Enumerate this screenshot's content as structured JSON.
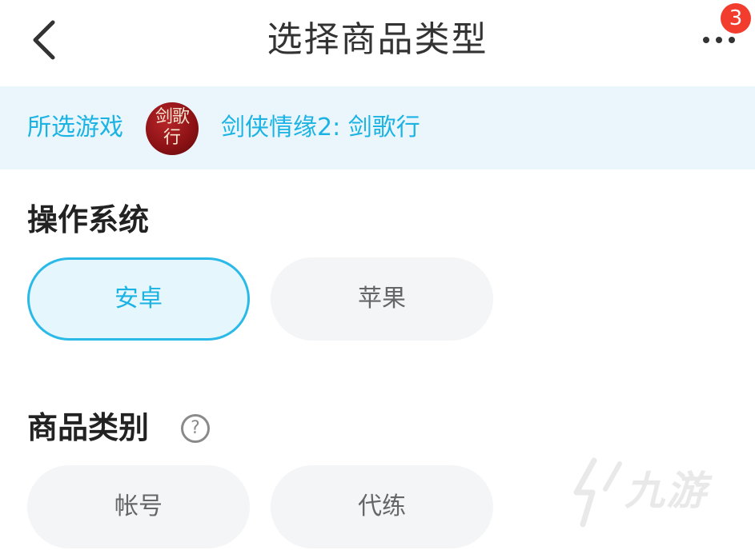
{
  "header": {
    "title": "选择商品类型",
    "back_icon": "chevron-left-icon",
    "more_icon": "more-horizontal-icon",
    "badge_count": "3"
  },
  "game": {
    "label": "所选游戏",
    "logo_text_top": "剑歌",
    "logo_text_bottom": "行",
    "name": "剑侠情缘2: 剑歌行"
  },
  "os": {
    "title": "操作系统",
    "options": [
      {
        "label": "安卓",
        "selected": true
      },
      {
        "label": "苹果",
        "selected": false
      }
    ]
  },
  "category": {
    "title": "商品类别",
    "help_icon": "question-circle-icon",
    "help_glyph": "?",
    "options": [
      {
        "label": "帐号",
        "selected": false
      },
      {
        "label": "代练",
        "selected": false
      }
    ]
  },
  "watermark": {
    "text": "九游"
  },
  "colors": {
    "accent": "#1ab3e3",
    "selected_border": "#2bbae8",
    "selected_bg": "#e6f6fd",
    "chip_bg": "#f4f5f7",
    "game_bar_bg": "#eaf6fc",
    "badge": "#f23c2e"
  }
}
